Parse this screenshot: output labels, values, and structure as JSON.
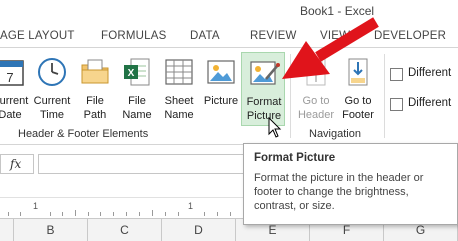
{
  "window": {
    "title": "Book1 - Excel"
  },
  "tabs": [
    "AGE LAYOUT",
    "FORMULAS",
    "DATA",
    "REVIEW",
    "VIEW",
    "DEVELOPER"
  ],
  "ribbon": {
    "buttons": {
      "current_date": {
        "line1": "Current",
        "line2": "Date"
      },
      "current_time": {
        "line1": "Current",
        "line2": "Time"
      },
      "file_path": {
        "line1": "File",
        "line2": "Path"
      },
      "file_name": {
        "line1": "File",
        "line2": "Name"
      },
      "sheet_name": {
        "line1": "Sheet",
        "line2": "Name"
      },
      "picture": {
        "line1": "Picture",
        "line2": ""
      },
      "format_picture": {
        "line1": "Format",
        "line2": "Picture"
      },
      "go_to_header": {
        "line1": "Go to",
        "line2": "Header"
      },
      "go_to_footer": {
        "line1": "Go to",
        "line2": "Footer"
      }
    },
    "groups": {
      "header_footer_elements": "Header & Footer Elements",
      "navigation": "Navigation"
    },
    "checkboxes": [
      "Different",
      "Different"
    ]
  },
  "formula_bar": {
    "fx_label": "fx",
    "value": ""
  },
  "ruler": {
    "numbers": [
      "1",
      "1"
    ]
  },
  "columns": [
    "B",
    "C",
    "D",
    "E",
    "F",
    "G"
  ],
  "tooltip": {
    "title": "Format Picture",
    "body": "Format the picture in the header or footer to change the brightness, contrast, or size."
  },
  "colors": {
    "annotation_arrow": "#e0141b",
    "active_button": "#d8eedb",
    "excel_green": "#217346"
  }
}
